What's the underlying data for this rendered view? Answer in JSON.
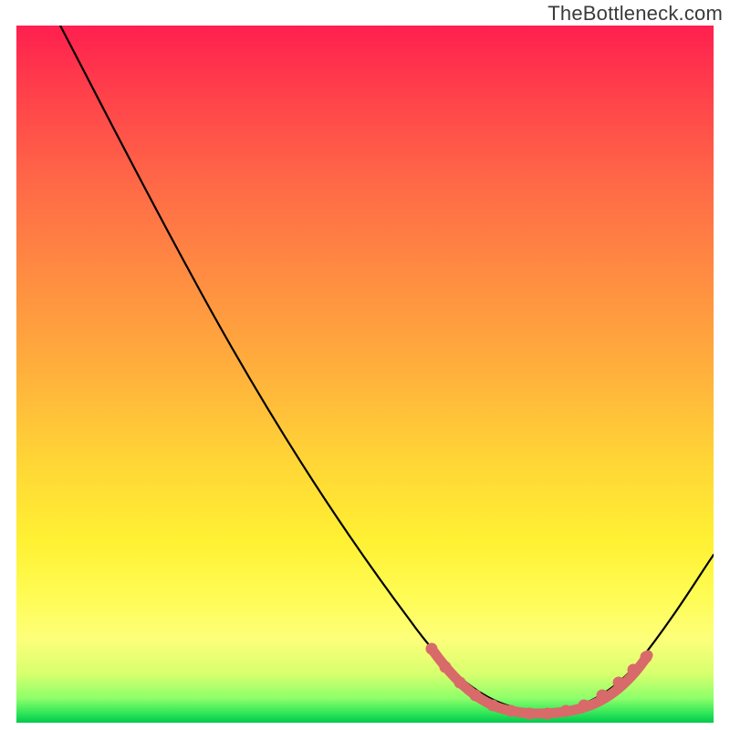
{
  "attribution": "TheBottleneck.com",
  "chart_data": {
    "type": "line",
    "title": "",
    "xlabel": "",
    "ylabel": "",
    "xlim": [
      0,
      100
    ],
    "ylim": [
      0,
      100
    ],
    "background_gradient": {
      "direction": "vertical",
      "stops": [
        {
          "pos": 0,
          "color": "#ff1f4f"
        },
        {
          "pos": 0.08,
          "color": "#ff3b4b"
        },
        {
          "pos": 0.22,
          "color": "#ff6747"
        },
        {
          "pos": 0.35,
          "color": "#ff8a42"
        },
        {
          "pos": 0.5,
          "color": "#ffb13c"
        },
        {
          "pos": 0.62,
          "color": "#ffd436"
        },
        {
          "pos": 0.74,
          "color": "#fff133"
        },
        {
          "pos": 0.82,
          "color": "#fffc55"
        },
        {
          "pos": 0.88,
          "color": "#fdff7a"
        },
        {
          "pos": 0.93,
          "color": "#d7ff6e"
        },
        {
          "pos": 0.965,
          "color": "#8dff6a"
        },
        {
          "pos": 0.985,
          "color": "#36e85a"
        },
        {
          "pos": 1.0,
          "color": "#00c94c"
        }
      ]
    },
    "series": [
      {
        "name": "bottleneck-curve",
        "color": "#000000",
        "x": [
          6,
          12,
          18,
          25,
          34,
          45,
          56,
          63,
          68,
          73,
          78,
          84,
          89,
          94,
          100
        ],
        "y": [
          100,
          89,
          79,
          65,
          48,
          31,
          15,
          6,
          3,
          2,
          1,
          2,
          8,
          16,
          24
        ]
      }
    ],
    "highlight": {
      "name": "optimal-range",
      "color": "#d86a6a",
      "style": "beaded",
      "x": [
        60,
        62,
        64,
        66,
        68,
        71,
        74,
        76,
        79,
        81,
        84,
        86,
        88,
        90
      ],
      "y": [
        11,
        8,
        6,
        4,
        2.5,
        1.5,
        1,
        1,
        1.5,
        2.5,
        4,
        6,
        8,
        10
      ]
    },
    "grid": false,
    "legend": {
      "visible": false
    }
  }
}
